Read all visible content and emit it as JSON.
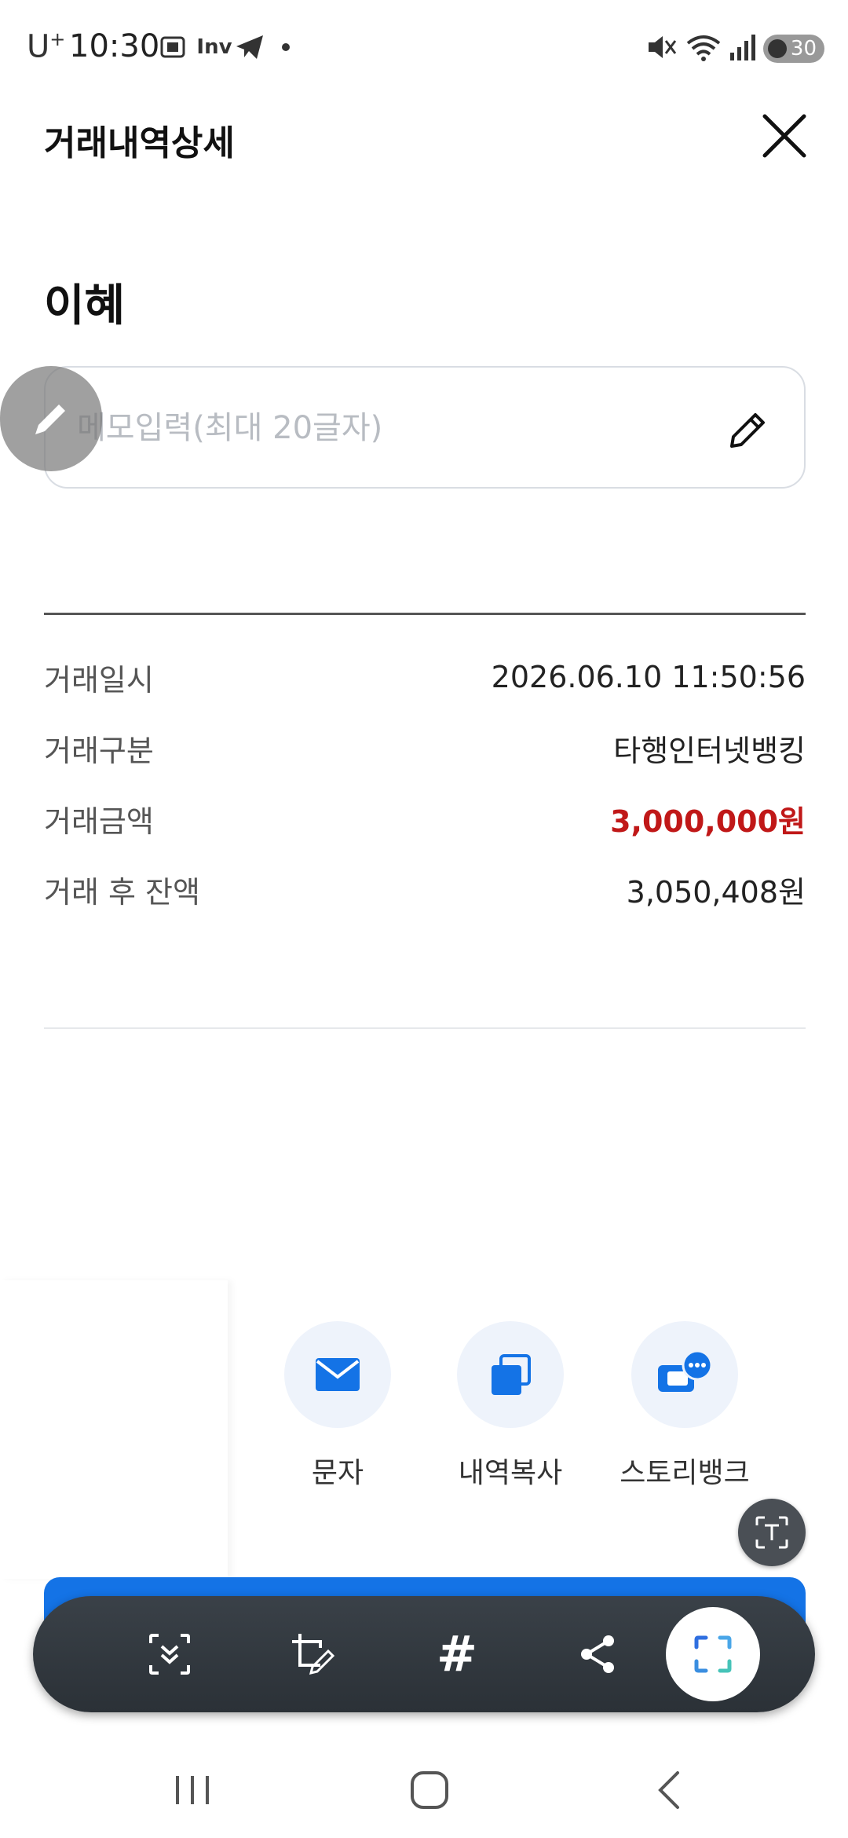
{
  "status_bar": {
    "carrier": "U",
    "carrier_suffix": "+",
    "time": "10:30",
    "app_icon_text": "Inv",
    "battery": "30"
  },
  "header": {
    "title": "거래내역상세"
  },
  "recipient": "이혜",
  "memo": {
    "placeholder": "메모입력(최대 20글자)",
    "value": ""
  },
  "details": [
    {
      "label": "거래일시",
      "value": "2026.06.10  11:50:56"
    },
    {
      "label": "거래구분",
      "value": "타행인터넷뱅킹"
    },
    {
      "label": "거래금액",
      "value": "3,000,000원"
    },
    {
      "label": "거래 후 잔액",
      "value": "3,050,408원"
    }
  ],
  "actions": [
    {
      "label": "문자",
      "icon": "mail-icon"
    },
    {
      "label": "내역복사",
      "icon": "copy-icon"
    },
    {
      "label": "스토리뱅크",
      "icon": "chat-bubble-icon"
    }
  ],
  "toolbar": {
    "hash": "#"
  },
  "colors": {
    "accent": "#1473e6",
    "amount": "#c01818",
    "toolbar": "#2f353b"
  }
}
